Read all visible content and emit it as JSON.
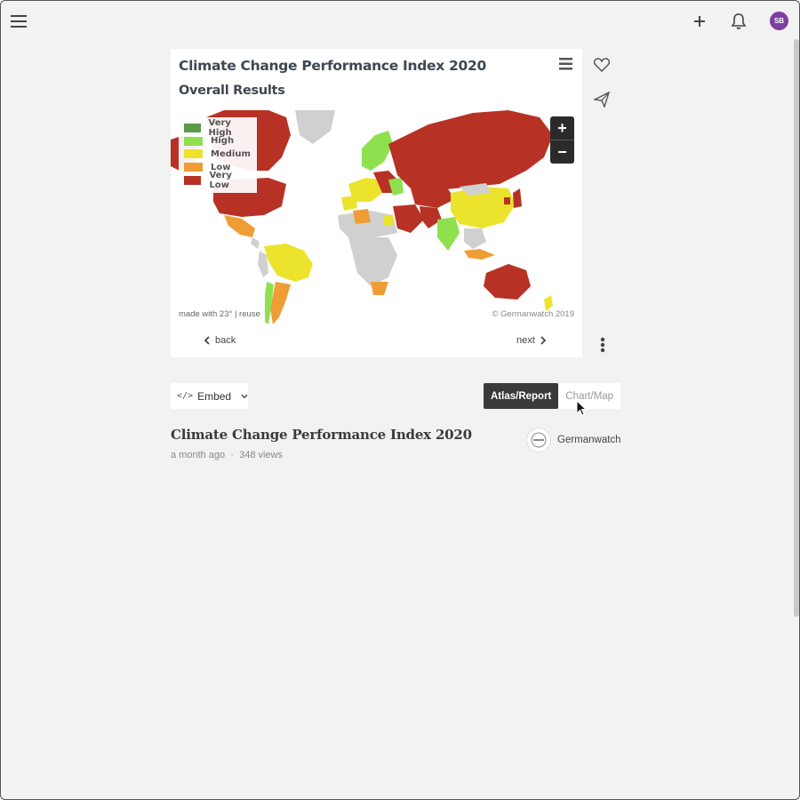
{
  "card": {
    "title": "Climate Change Performance Index 2020",
    "subtitle": "Overall Results"
  },
  "legend": [
    {
      "label": "Very High",
      "color": "#5a9a4c"
    },
    {
      "label": "High",
      "color": "#8ee04f"
    },
    {
      "label": "Medium",
      "color": "#ece32c"
    },
    {
      "label": "Low",
      "color": "#ee9e35"
    },
    {
      "label": "Very Low",
      "color": "#b73224"
    }
  ],
  "map": {
    "no_data_color": "#d0d0d0",
    "zoom_in_label": "+",
    "zoom_out_label": "−",
    "credit_left": "made with 23° | reuse",
    "credit_right": "© Germanwatch 2019"
  },
  "nav": {
    "back_label": "back",
    "next_label": "next"
  },
  "actions": {
    "embed_label": "Embed",
    "embed_icon": "</>",
    "toggle_active": "Atlas/Report",
    "toggle_inactive": "Chart/Map"
  },
  "item": {
    "title": "Climate Change Performance Index 2020",
    "time": "a month ago",
    "separator": "·",
    "views": "348 views",
    "author": "Germanwatch"
  },
  "user": {
    "initials": "SB",
    "avatar_color": "#7b3fa0"
  },
  "icons": [
    "menu-icon",
    "plus-icon",
    "bell-icon",
    "heart-icon",
    "send-icon",
    "more-vertical-icon",
    "chevron-left-icon",
    "chevron-right-icon",
    "chevron-down-icon"
  ]
}
